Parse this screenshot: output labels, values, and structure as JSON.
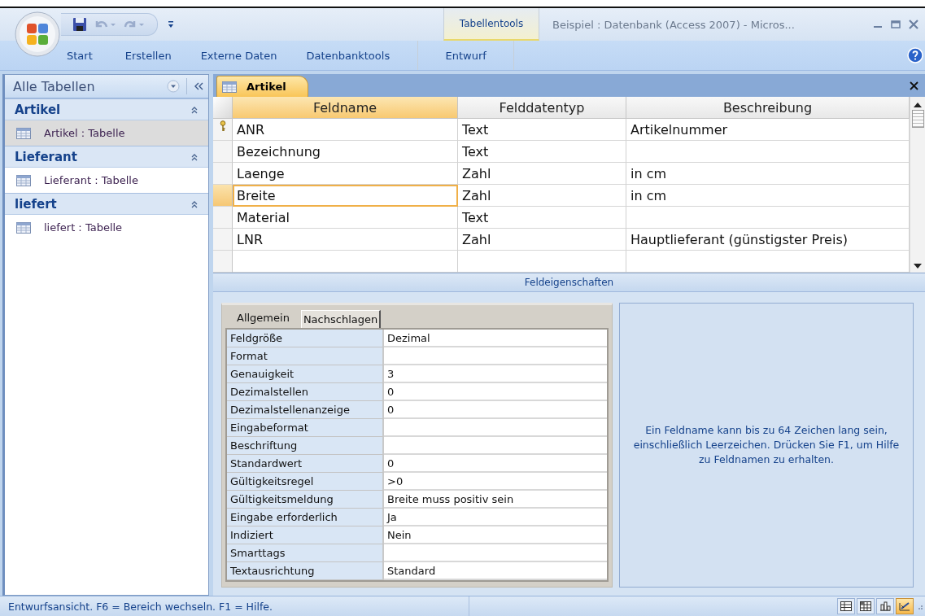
{
  "window": {
    "title": "Beispiel : Datenbank (Access 2007) - Micros..."
  },
  "ribbon": {
    "contextual_group": "Tabellentools",
    "tabs": [
      {
        "label": "Start",
        "selected": false
      },
      {
        "label": "Erstellen",
        "selected": false
      },
      {
        "label": "Externe Daten",
        "selected": false
      },
      {
        "label": "Datenbanktools",
        "selected": false
      }
    ],
    "contextual_tabs": [
      {
        "label": "Entwurf",
        "selected": false
      }
    ]
  },
  "nav_pane": {
    "title": "Alle Tabellen",
    "groups": [
      {
        "title": "Artikel",
        "expanded": true,
        "items": [
          {
            "label": "Artikel : Tabelle",
            "selected": true
          }
        ]
      },
      {
        "title": "Lieferant",
        "expanded": true,
        "items": [
          {
            "label": "Lieferant : Tabelle",
            "selected": false
          }
        ]
      },
      {
        "title": "liefert",
        "expanded": true,
        "items": [
          {
            "label": "liefert : Tabelle",
            "selected": false
          }
        ]
      }
    ]
  },
  "document_tabs": [
    {
      "label": "Artikel",
      "selected": true
    }
  ],
  "design_grid": {
    "columns": [
      "Feldname",
      "Felddatentyp",
      "Beschreibung"
    ],
    "rows": [
      {
        "field_name": "ANR",
        "data_type": "Text",
        "description": "Artikelnummer",
        "primary_key": true,
        "selected": false
      },
      {
        "field_name": "Bezeichnung",
        "data_type": "Text",
        "primary_key": false,
        "selected": false
      },
      {
        "field_name": "Laenge",
        "data_type": "Zahl",
        "description": "in cm",
        "primary_key": false,
        "selected": false
      },
      {
        "field_name": "Breite",
        "data_type": "Zahl",
        "description": "in cm",
        "primary_key": false,
        "selected": true
      },
      {
        "field_name": "Material",
        "data_type": "Text",
        "primary_key": false,
        "selected": false
      },
      {
        "field_name": "LNR",
        "data_type": "Zahl",
        "description": "Hauptlieferant (günstigster Preis)",
        "primary_key": false,
        "selected": false
      }
    ]
  },
  "field_properties": {
    "caption": "Feldeigenschaften",
    "tabs": [
      {
        "label": "Allgemein",
        "selected": true
      },
      {
        "label": "Nachschlagen",
        "selected": false
      }
    ],
    "properties": [
      {
        "name": "Feldgröße",
        "value": "Dezimal"
      },
      {
        "name": "Format"
      },
      {
        "name": "Genauigkeit",
        "value": "3"
      },
      {
        "name": "Dezimalstellen",
        "value": "0"
      },
      {
        "name": "Dezimalstellenanzeige",
        "value": "0"
      },
      {
        "name": "Eingabeformat"
      },
      {
        "name": "Beschriftung"
      },
      {
        "name": "Standardwert",
        "value": "0"
      },
      {
        "name": "Gültigkeitsregel",
        "value": ">0"
      },
      {
        "name": "Gültigkeitsmeldung",
        "value": "Breite muss positiv sein"
      },
      {
        "name": "Eingabe erforderlich",
        "value": "Ja"
      },
      {
        "name": "Indiziert",
        "value": "Nein"
      },
      {
        "name": "Smarttags"
      },
      {
        "name": "Textausrichtung",
        "value": "Standard"
      }
    ],
    "help_text": "Ein Feldname kann bis zu 64 Zeichen lang sein, einschließlich Leerzeichen. Drücken Sie F1, um Hilfe zu Feldnamen zu erhalten."
  },
  "status_bar": {
    "text": "Entwurfsansicht. F6 = Bereich wechseln. F1 = Hilfe.",
    "view_buttons": [
      {
        "kind": "datasheet",
        "selected": false
      },
      {
        "kind": "pivot_table",
        "selected": false
      },
      {
        "kind": "pivot_chart",
        "selected": false
      },
      {
        "kind": "design",
        "selected": true
      }
    ]
  }
}
